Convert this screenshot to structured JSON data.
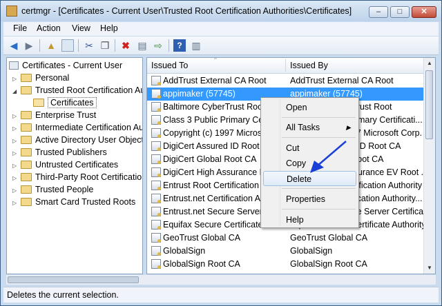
{
  "window": {
    "title": "certmgr - [Certificates - Current User\\Trusted Root Certification Authorities\\Certificates]",
    "minimize": "–",
    "maximize": "□",
    "close": "✕"
  },
  "menu": [
    "File",
    "Action",
    "View",
    "Help"
  ],
  "toolbar_icons": [
    "back-arrow-icon",
    "forward-arrow-icon",
    "up-folder-icon",
    "show-tree-icon",
    "cut-icon",
    "copy-icon",
    "delete-icon",
    "properties-icon",
    "export-icon",
    "help-icon",
    "panel-icon"
  ],
  "tree": {
    "root": "Certificates - Current User",
    "items": [
      "Personal",
      "Trusted Root Certification Au",
      "Certificates",
      "Enterprise Trust",
      "Intermediate Certification Au",
      "Active Directory User Object",
      "Trusted Publishers",
      "Untrusted Certificates",
      "Third-Party Root Certification",
      "Trusted People",
      "Smart Card Trusted Roots"
    ]
  },
  "list": {
    "columns": [
      "Issued To",
      "Issued By"
    ],
    "rows": [
      [
        "AddTrust External CA Root",
        "AddTrust External CA Root"
      ],
      [
        "appimaker (57745)",
        "appimaker (57745)"
      ],
      [
        "Baltimore CyberTrust Root",
        "Baltimore CyberTrust Root"
      ],
      [
        "Class 3 Public Primary Cert",
        "Class 3 Public Primary Certificati..."
      ],
      [
        "Copyright (c) 1997 Microso",
        "Copyright (c) 1997 Microsoft Corp."
      ],
      [
        "DigiCert Assured ID Root CA",
        "DigiCert Assured ID Root CA"
      ],
      [
        "DigiCert Global Root CA",
        "DigiCert Global Root CA"
      ],
      [
        "DigiCert High Assurance EV",
        "DigiCert High Assurance EV Root ..."
      ],
      [
        "Entrust Root Certification A",
        "Entrust Root Certification Authority"
      ],
      [
        "Entrust.net Certification Au",
        "Entrust.net Certification Authority..."
      ],
      [
        "Entrust.net Secure Server C",
        "Entrust.net Secure Server Certifica..."
      ],
      [
        "Equifax Secure Certificate A",
        "Equifax Secure Certificate Authority"
      ],
      [
        "GeoTrust Global CA",
        "GeoTrust Global CA"
      ],
      [
        "GlobalSign",
        "GlobalSign"
      ],
      [
        "GlobalSign Root CA",
        "GlobalSign Root CA"
      ]
    ]
  },
  "context_menu": {
    "open": "Open",
    "all_tasks": "All Tasks",
    "cut": "Cut",
    "copy": "Copy",
    "delete": "Delete",
    "properties": "Properties",
    "help": "Help"
  },
  "status": "Deletes the current selection.",
  "colors": {
    "selection": "#3399ff",
    "arrow": "#1a3fd6"
  }
}
